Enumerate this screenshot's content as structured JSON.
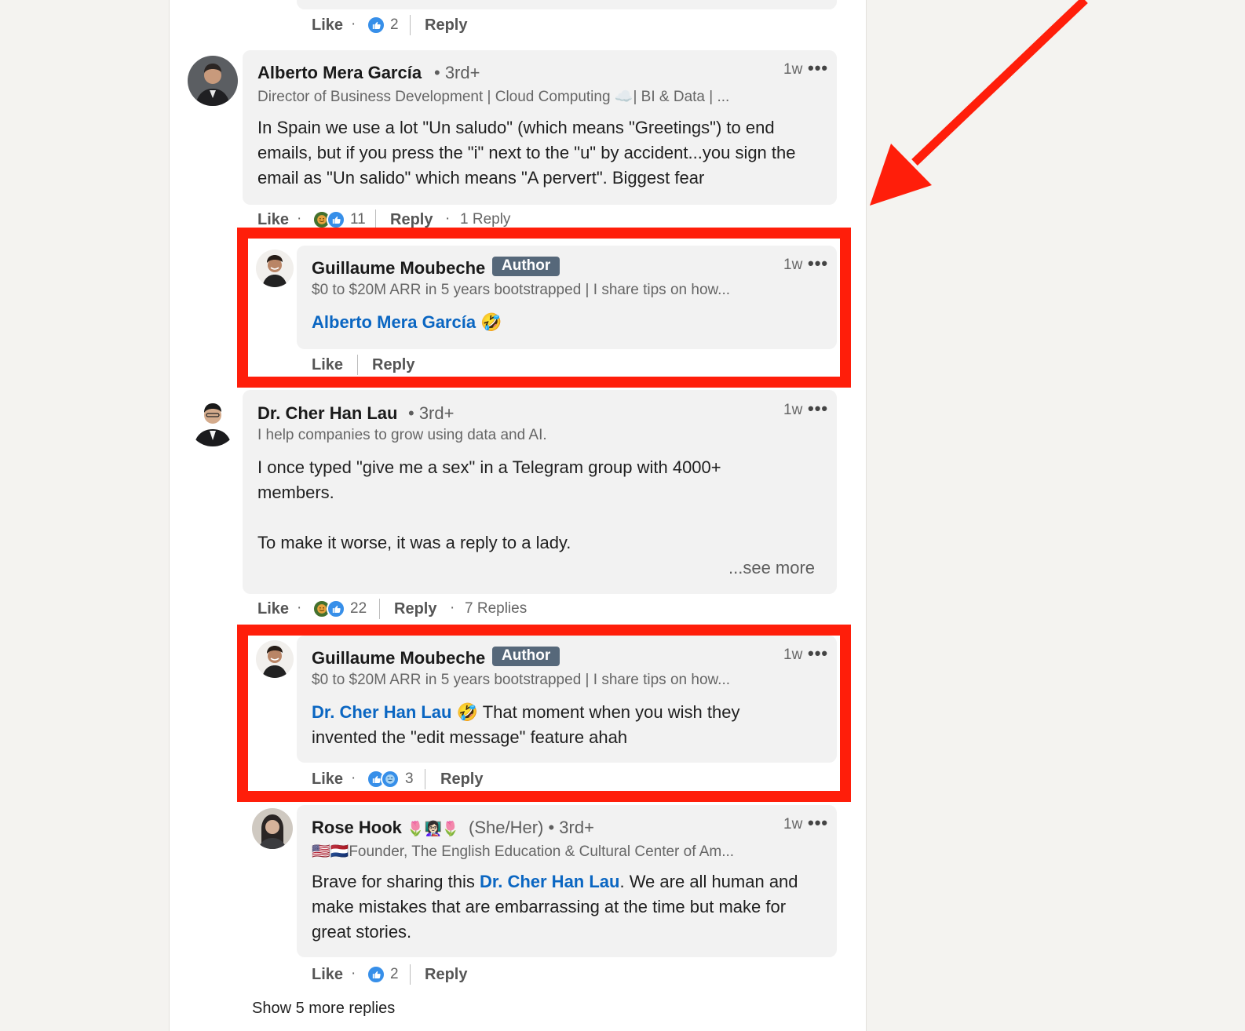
{
  "colors": {
    "highlight": "#ff1e0a",
    "link": "#0a66c2",
    "badge": "#56687a",
    "like_blue": "#378fe9"
  },
  "top_actions": {
    "like": "Like",
    "count": "2",
    "reply": "Reply"
  },
  "comments": [
    {
      "name": "Alberto Mera García",
      "degree": "• 3rd+",
      "headline": "Director of Business Development | Cloud Computing ☁️| BI & Data | ...",
      "time": "1w",
      "text": "In Spain we use a lot \"Un saludo\" (which means \"Greetings\") to end emails, but if you press the \"i\" next to the \"u\" by accident...you sign the email as \"Un salido\" which means \"A pervert\". Biggest fear",
      "like": "Like",
      "reactions": "11",
      "reply": "Reply",
      "replies": "1 Reply",
      "reply_item": {
        "name": "Guillaume Moubeche",
        "badge": "Author",
        "headline": "$0 to $20M ARR in 5 years bootstrapped | I share tips on how...",
        "time": "1w",
        "mention": "Alberto Mera García",
        "emoji": "🤣",
        "text": "",
        "like": "Like",
        "reply": "Reply"
      }
    },
    {
      "name": "Dr. Cher Han Lau",
      "degree": "• 3rd+",
      "headline": "I help companies to grow using data and AI.",
      "time": "1w",
      "text_line1": "I once typed \"give me a sex\" in a Telegram group with 4000+",
      "text_line2": "members.",
      "text_line3": "To make it worse, it was a reply to a lady.",
      "see_more": "...see more",
      "like": "Like",
      "reactions": "22",
      "reply": "Reply",
      "replies": "7 Replies",
      "reply_item": {
        "name": "Guillaume Moubeche",
        "badge": "Author",
        "headline": "$0 to $20M ARR in 5 years bootstrapped | I share tips on how...",
        "time": "1w",
        "mention": "Dr. Cher Han Lau",
        "emoji": "🤣",
        "text_a": " That moment when you wish they",
        "text_b": "invented the \"edit message\" feature ahah",
        "like": "Like",
        "reactions": "3",
        "reply": "Reply"
      },
      "reply_item2": {
        "name": "Rose Hook",
        "name_emojis": "🌷👩🏻‍🏫🌷",
        "pronouns": "(She/Her) • 3rd+",
        "headline": "🇺🇸🇳🇱Founder, The English Education & Cultural Center of Am...",
        "time": "1w",
        "text_a": "Brave for sharing this ",
        "mention": "Dr. Cher Han Lau",
        "text_b": ". We are all human and",
        "text_c": "make mistakes that are embarrassing at the time but make for",
        "text_d": "great stories.",
        "like": "Like",
        "reactions": "2",
        "reply": "Reply"
      }
    }
  ],
  "show_more": "Show 5 more replies"
}
